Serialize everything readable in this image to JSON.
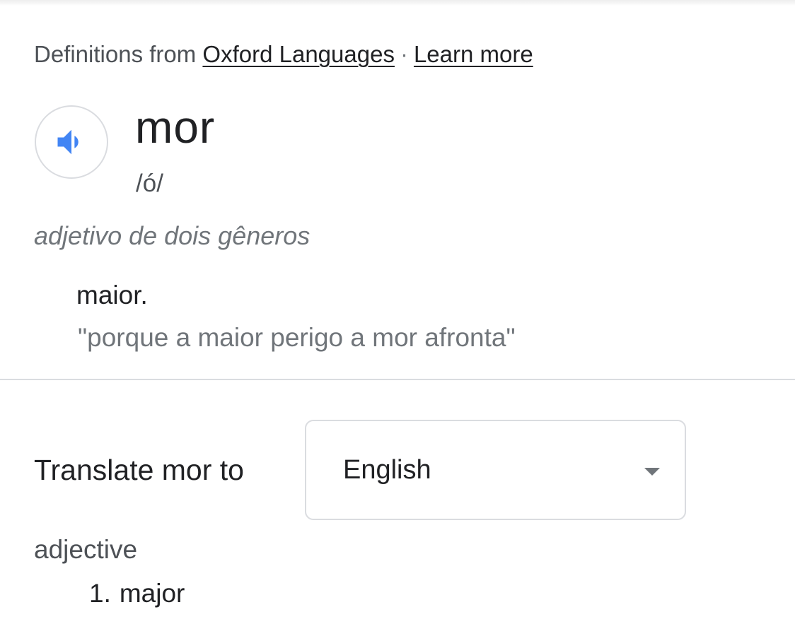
{
  "source": {
    "prefix": "Definitions from",
    "provider_link": "Oxford Languages",
    "separator": "·",
    "learn_more_link": "Learn more"
  },
  "entry": {
    "audio_icon": "speaker-icon",
    "word": "mor",
    "phonetic": "/ó/",
    "part_of_speech": "adjetivo de dois gêneros",
    "definition": "maior.",
    "example": "\"porque a maior perigo a mor afronta\""
  },
  "translate": {
    "label": "Translate mor to",
    "selected_language": "English",
    "dropdown_icon": "caret-down-icon",
    "part_of_speech": "adjective",
    "results": [
      {
        "number": "1.",
        "text": "major"
      }
    ]
  },
  "colors": {
    "accent_blue": "#4285f4",
    "text_primary": "#202124",
    "text_secondary": "#70757a",
    "border": "#dadce0"
  }
}
